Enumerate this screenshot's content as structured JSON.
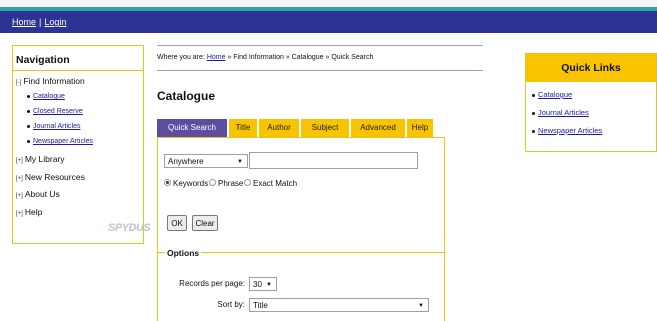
{
  "header": {
    "home": "Home",
    "separator": "|",
    "login": "Login"
  },
  "nav": {
    "title": "Navigation",
    "find_information": "Find Information",
    "sub_items": [
      "Catalogue",
      "Closed Reserve",
      "Journal Articles",
      "Newspaper Articles"
    ],
    "my_library": "My Library",
    "new_resources": "New Resources",
    "about_us": "About Us",
    "help": "Help",
    "expanded_marker": "[-]",
    "collapsed_marker": "[+]",
    "logo_text": "SPYDUS"
  },
  "breadcrumb": {
    "prefix": "Where you are:",
    "home": "Home",
    "trail": "» Find Information » Catalogue » Quick Search"
  },
  "page_title": "Catalogue",
  "tabs": [
    "Quick Search",
    "Title",
    "Author",
    "Subject",
    "Advanced",
    "Help"
  ],
  "search": {
    "field_select": "Anywhere",
    "query_value": "",
    "match_options": [
      "Keywords",
      "Phrase",
      "Exact Match"
    ],
    "selected_match": "Keywords",
    "ok_label": "OK",
    "clear_label": "Clear"
  },
  "options": {
    "title": "Options",
    "records_label": "Records per page:",
    "records_value": "30",
    "sort_label": "Sort by:",
    "sort_value": "Title"
  },
  "quick_links": {
    "title": "Quick Links",
    "items": [
      "Catalogue",
      "Journal Articles",
      "Newspaper Articles"
    ]
  },
  "colors": {
    "header_bar": "#2d3394",
    "accent_yellow": "#f8c400",
    "active_tab": "#5b4ea0",
    "border_yellow": "#e8c51a"
  }
}
